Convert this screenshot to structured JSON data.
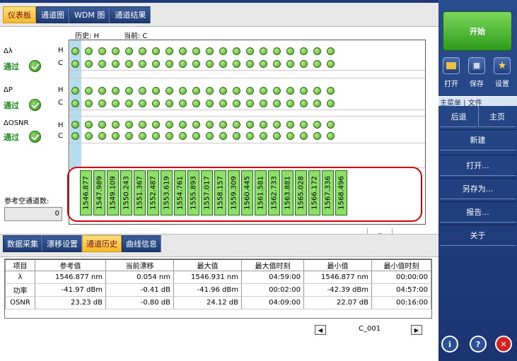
{
  "top_tabs": [
    "仪表板",
    "通道图",
    "WDM 图",
    "通道结果"
  ],
  "header": {
    "history": "历史: H",
    "current": "当前: C"
  },
  "params": [
    {
      "name": "Δλ",
      "status": "通过"
    },
    {
      "name": "ΔP",
      "status": "通过"
    },
    {
      "name": "ΔOSNR",
      "status": "通过"
    }
  ],
  "row_labels": {
    "h": "H",
    "c": "C"
  },
  "wavelengths": [
    "1546.877",
    "1547.989",
    "1549.109",
    "1550.243",
    "1551.367",
    "1552.487",
    "1553.619",
    "1554.761",
    "1555.893",
    "1557.017",
    "1558.157",
    "1559.309",
    "1560.445",
    "1561.581",
    "1562.733",
    "1563.881",
    "1565.028",
    "1566.172",
    "1567.336",
    "1568.496"
  ],
  "ref_channel_label": "参考空通道数:",
  "ref_channel_value": "0",
  "bottom_tabs": [
    "数据采集",
    "漂移设置",
    "通道历史",
    "曲线信息"
  ],
  "table": {
    "headers": [
      "项目",
      "参考值",
      "当前漂移",
      "最大值",
      "最大值时刻",
      "最小值",
      "最小值时刻"
    ],
    "rows": [
      [
        "λ",
        "1546.877 nm",
        "0.054 nm",
        "1546.931 nm",
        "04:59:00",
        "1546.877 nm",
        "00:00:00"
      ],
      [
        "功率",
        "-41.97 dBm",
        "-0.41 dB",
        "-41.96 dBm",
        "00:02:00",
        "-42.39 dBm",
        "04:57:00"
      ],
      [
        "OSNR",
        "23.23 dB",
        "-0.80 dB",
        "24.12 dB",
        "04:09:00",
        "22.07 dB",
        "00:16:00"
      ]
    ]
  },
  "pager_label": "C_001",
  "right_panel": {
    "start": "开始",
    "open": "打开",
    "save": "保存",
    "settings": "设置",
    "menu_header": "主菜单 | 文件",
    "back": "后退",
    "home": "主页",
    "new": "新建",
    "open_dots": "打开...",
    "save_as": "另存为...",
    "report": "报告...",
    "about": "关于"
  },
  "colors": {
    "accent_tab": "#f3b92a",
    "nav_blue": "#1e3a72",
    "dot_green": "#4fa92a",
    "highlight_red": "#d20000"
  }
}
